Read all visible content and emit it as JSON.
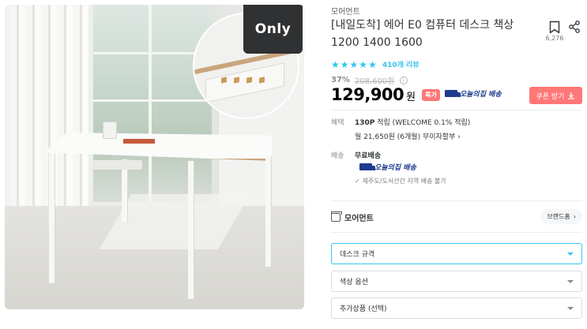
{
  "product_image": {
    "badge": "Only"
  },
  "product": {
    "brand": "모어먼트",
    "title": "[내일도착] 에어 E0 컴퓨터 데스크 책상 1200 1400 1600",
    "scrap_count": "6,276",
    "review_count": "410개 리뷰",
    "rating_stars": 5,
    "discount": "37%",
    "original_price": "208,600원",
    "price": "129,900",
    "currency": "원",
    "special_badge": "특가",
    "today_delivery_label": "오늘의집 배송",
    "coupon_label": "쿠폰 받기"
  },
  "benefit": {
    "label": "혜택",
    "points": "130P",
    "points_text": "적립 (WELCOME 0.1% 적립)",
    "installment": "월 21,650원 (6개월) 무이자할부"
  },
  "shipping": {
    "label": "배송",
    "fee": "무료배송",
    "logo_label": "오늘의집 배송",
    "note": "제주도/도서산간 지역 배송 불가"
  },
  "brand_section": {
    "name": "모어먼트",
    "home_label": "브랜드홈"
  },
  "options": [
    {
      "label": "데스크 규격"
    },
    {
      "label": "색상 옵션"
    },
    {
      "label": "추가상품 (선택)"
    }
  ],
  "colors": {
    "accent": "#35c5f0",
    "sale": "#ff7777",
    "delivery": "#1f3b8f"
  }
}
